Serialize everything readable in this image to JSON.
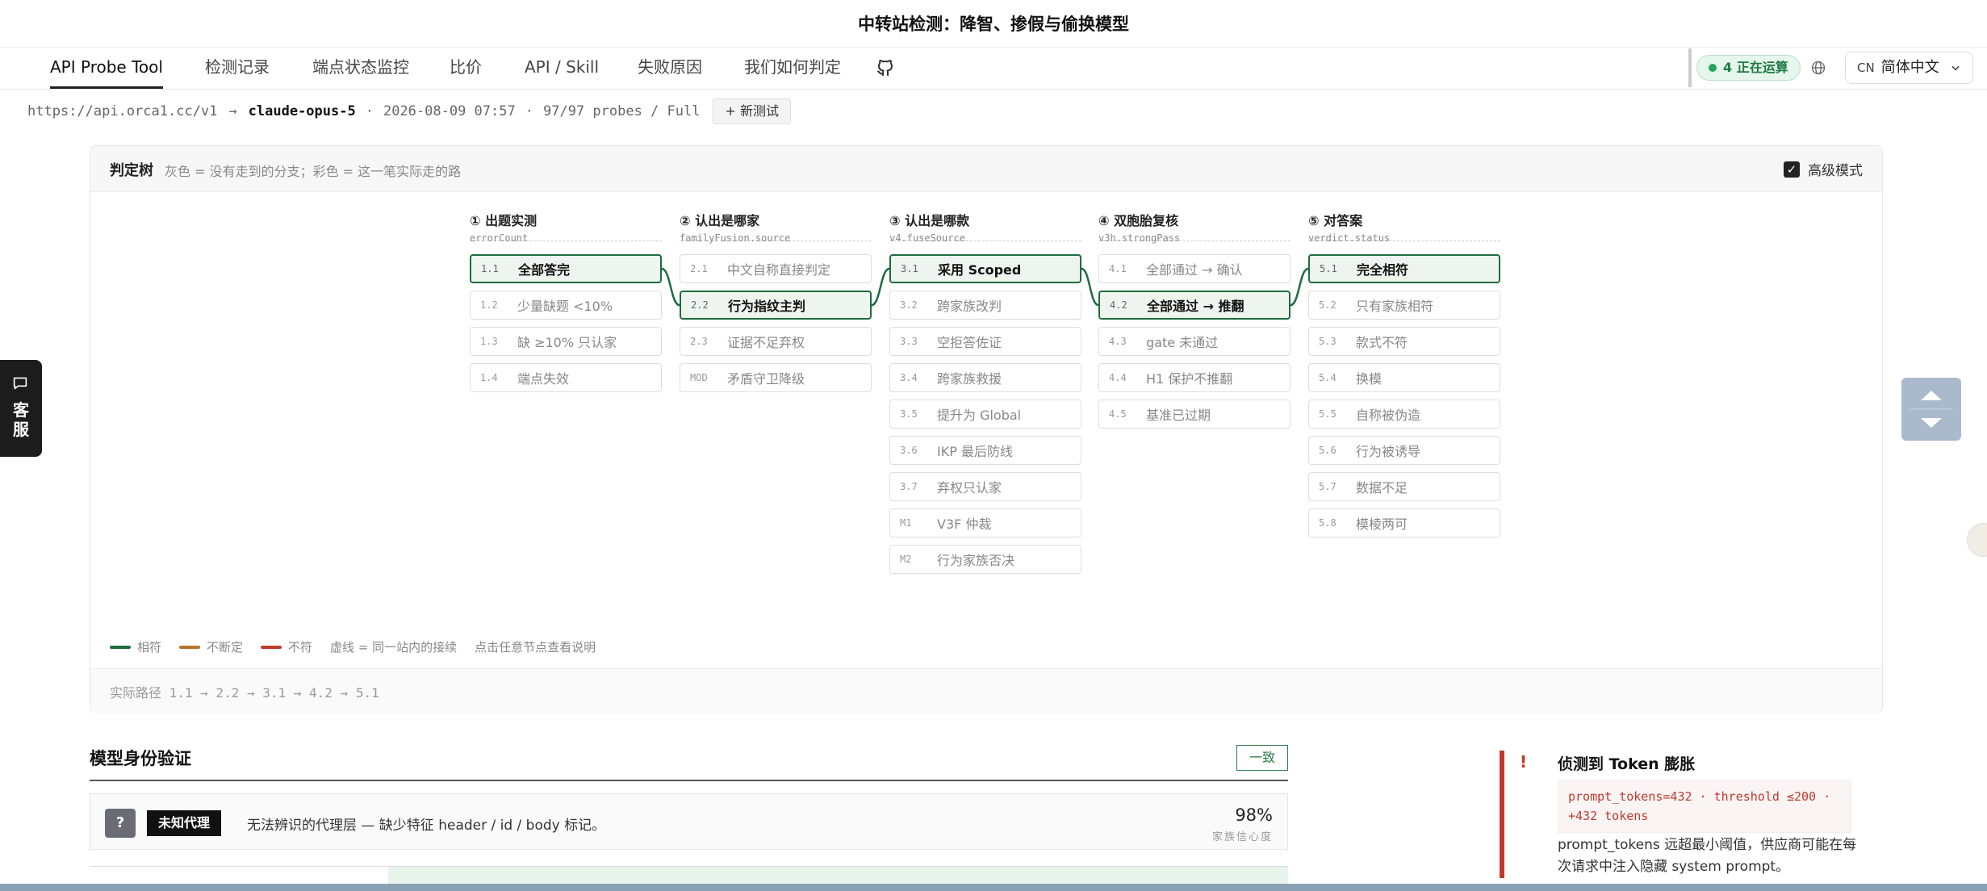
{
  "window": {
    "title": "中转站检测：降智、掺假与偷换模型"
  },
  "nav": {
    "tabs": [
      "API Probe Tool",
      "检测记录",
      "端点状态监控",
      "比价",
      "API / Skill",
      "失败原因",
      "我们如何判定"
    ],
    "active_tab": "API Probe Tool",
    "running_badge": "4 正在运算",
    "lang_code": "CN",
    "lang_label": "简体中文",
    "icons": [
      "github-icon",
      "globe-icon",
      "chevron-down-icon"
    ]
  },
  "run": {
    "endpoint": "https://api.orca1.cc/v1",
    "arrow": "→",
    "model": "claude-opus-5",
    "sep": "·",
    "datetime": "2026-08-09 07:57",
    "probes": "97/97 probes / Full",
    "new_test_button": "+ 新测试"
  },
  "tree": {
    "title": "判定树",
    "subtitle": "灰色 = 没有走到的分支；彩色 = 这一笔实际走的路",
    "advanced_mode_label": "高级模式",
    "advanced_mode_checked": true,
    "columns": [
      {
        "title": "① 出题实测",
        "field": "errorCount",
        "nodes": [
          {
            "id": "1.1",
            "label": "全部答完",
            "active": true
          },
          {
            "id": "1.2",
            "label": "少量缺题 <10%",
            "active": false
          },
          {
            "id": "1.3",
            "label": "缺 ≥10% 只认家",
            "active": false
          },
          {
            "id": "1.4",
            "label": "端点失效",
            "active": false
          }
        ]
      },
      {
        "title": "② 认出是哪家",
        "field": "familyFusion.source",
        "nodes": [
          {
            "id": "2.1",
            "label": "中文自称直接判定",
            "active": false
          },
          {
            "id": "2.2",
            "label": "行为指纹主判",
            "active": true
          },
          {
            "id": "2.3",
            "label": "证据不足弃权",
            "active": false
          },
          {
            "id": "MOD",
            "label": "矛盾守卫降级",
            "active": false
          }
        ]
      },
      {
        "title": "③ 认出是哪款",
        "field": "v4.fuseSource",
        "nodes": [
          {
            "id": "3.1",
            "label": "采用 Scoped",
            "active": true
          },
          {
            "id": "3.2",
            "label": "跨家族改判",
            "active": false
          },
          {
            "id": "3.3",
            "label": "空拒答佐证",
            "active": false
          },
          {
            "id": "3.4",
            "label": "跨家族救援",
            "active": false
          },
          {
            "id": "3.5",
            "label": "提升为 Global",
            "active": false
          },
          {
            "id": "3.6",
            "label": "IKP 最后防线",
            "active": false
          },
          {
            "id": "3.7",
            "label": "弃权只认家",
            "active": false
          },
          {
            "id": "M1",
            "label": "V3F 仲裁",
            "active": false
          },
          {
            "id": "M2",
            "label": "行为家族否决",
            "active": false
          }
        ]
      },
      {
        "title": "④ 双胞胎复核",
        "field": "v3h.strongPass",
        "nodes": [
          {
            "id": "4.1",
            "label": "全部通过 → 确认",
            "active": false
          },
          {
            "id": "4.2",
            "label": "全部通过 → 推翻",
            "active": true
          },
          {
            "id": "4.3",
            "label": "gate 未通过",
            "active": false
          },
          {
            "id": "4.4",
            "label": "H1 保护不推翻",
            "active": false
          },
          {
            "id": "4.5",
            "label": "基准已过期",
            "active": false
          }
        ]
      },
      {
        "title": "⑤ 对答案",
        "field": "verdict.status",
        "nodes": [
          {
            "id": "5.1",
            "label": "完全相符",
            "active": true
          },
          {
            "id": "5.2",
            "label": "只有家族相符",
            "active": false
          },
          {
            "id": "5.3",
            "label": "款式不符",
            "active": false
          },
          {
            "id": "5.4",
            "label": "换模",
            "active": false
          },
          {
            "id": "5.5",
            "label": "自称被伪造",
            "active": false
          },
          {
            "id": "5.6",
            "label": "行为被诱导",
            "active": false
          },
          {
            "id": "5.7",
            "label": "数据不足",
            "active": false
          },
          {
            "id": "5.8",
            "label": "模棱两可",
            "active": false
          }
        ]
      }
    ],
    "legend": {
      "match": "相符",
      "uncertain": "不断定",
      "mismatch": "不符",
      "dashed_note": "虚线 = 同一站内的接续",
      "click_note": "点击任意节点查看说明"
    },
    "colors": {
      "match": "#1f6b3f",
      "uncertain": "#b8732a",
      "mismatch": "#c0392b"
    },
    "actual_path": "实际路径 1.1 → 2.2 → 3.1 → 4.2 → 5.1"
  },
  "side_tab": {
    "label": "客服",
    "icon": "chat-icon"
  },
  "identity": {
    "title": "模型身份验证",
    "status_badge": "一致",
    "card": {
      "icon_glyph": "?",
      "tag": "未知代理",
      "description": "无法辨识的代理层 — 缺少特征 header / id / body 标记。",
      "confidence": "98%",
      "confidence_label": "家族信心度"
    }
  },
  "alert": {
    "mark": "!",
    "title": "侦测到 Token 膨胀",
    "code": "prompt_tokens=432 · threshold ≤200 · +432 tokens",
    "description": "prompt_tokens 远超最小阈值，供应商可能在每次请求中注入隐藏 system prompt。"
  }
}
